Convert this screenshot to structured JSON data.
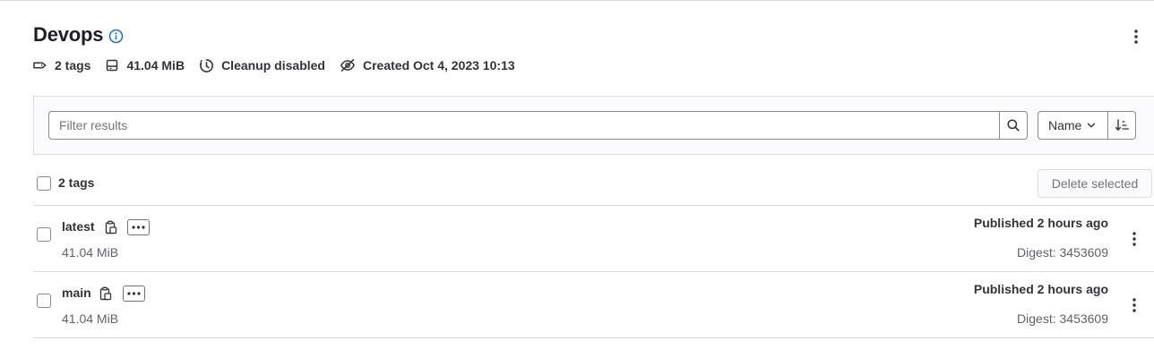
{
  "header": {
    "title": "Devops",
    "meta": {
      "tags": "2 tags",
      "size": "41.04 MiB",
      "cleanup": "Cleanup disabled",
      "created": "Created Oct 4, 2023 10:13"
    }
  },
  "filter": {
    "placeholder": "Filter results",
    "value": "",
    "sort_label": "Name"
  },
  "list": {
    "select_all_label": "2 tags",
    "delete_label": "Delete selected",
    "rows": [
      {
        "name": "latest",
        "size": "41.04 MiB",
        "published": "Published 2 hours ago",
        "digest": "Digest: 3453609"
      },
      {
        "name": "main",
        "size": "41.04 MiB",
        "published": "Published 2 hours ago",
        "digest": "Digest: 3453609"
      }
    ]
  },
  "icons": {
    "info": "information-o-icon",
    "tag": "label-icon",
    "storage": "disk-icon",
    "cleanup": "expire-icon",
    "visibility": "eye-slash-icon",
    "search": "search-icon",
    "sort_chevron": "chevron-down-icon",
    "sort_direction": "sort-lowest-icon",
    "copy": "copy-to-clipboard-icon",
    "ellipsis": "ellipsis-h-icon",
    "kebab": "ellipsis-v-icon"
  },
  "colors": {
    "accent": "#1f75cb",
    "text": "#333238",
    "muted": "#626168",
    "border": "#dcdcde",
    "filter_bg": "#fbfafd"
  }
}
